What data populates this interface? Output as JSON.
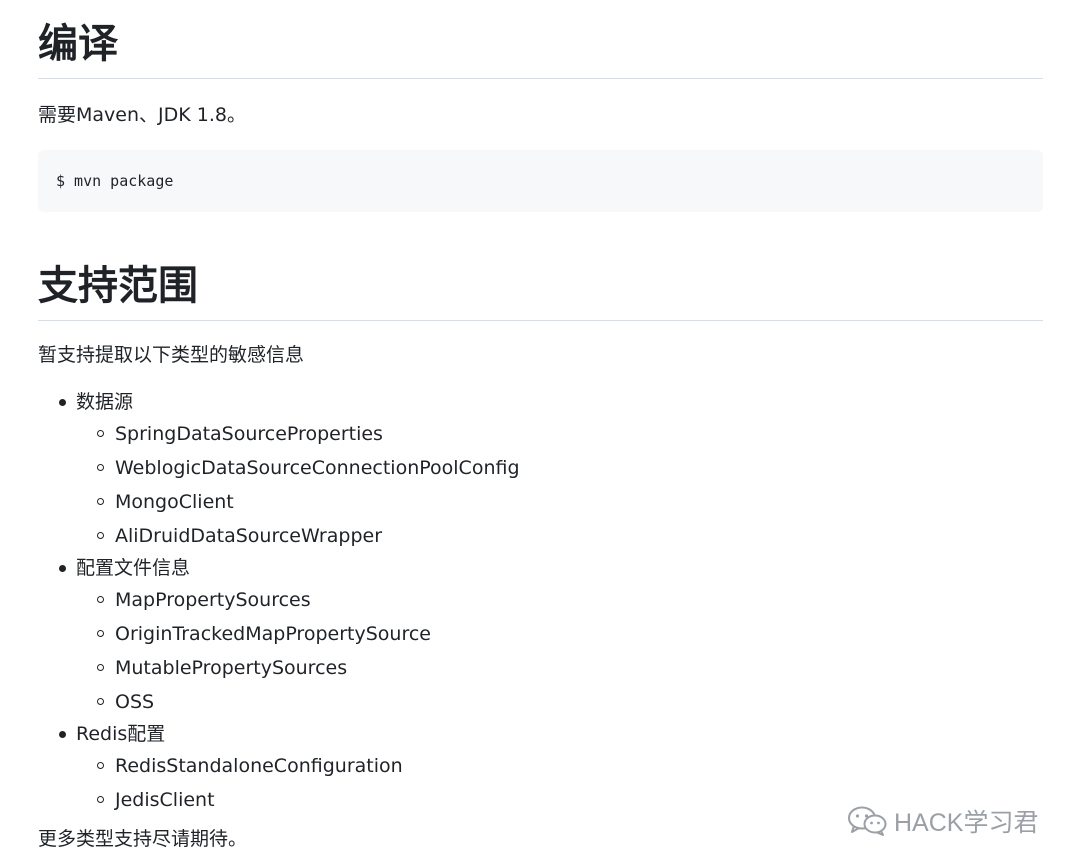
{
  "sections": {
    "compile": {
      "heading": "编译",
      "requirement": "需要Maven、JDK 1.8。",
      "code": "$ mvn package"
    },
    "scope": {
      "heading": "支持范围",
      "intro": "暂支持提取以下类型的敏感信息",
      "groups": [
        {
          "label": "数据源",
          "items": [
            "SpringDataSourceProperties",
            "WeblogicDataSourceConnectionPoolConfig",
            "MongoClient",
            "AliDruidDataSourceWrapper"
          ]
        },
        {
          "label": "配置文件信息",
          "items": [
            "MapPropertySources",
            "OriginTrackedMapPropertySource",
            "MutablePropertySources",
            "OSS"
          ]
        },
        {
          "label": "Redis配置",
          "items": [
            "RedisStandaloneConfiguration",
            "JedisClient"
          ]
        }
      ],
      "footer": "更多类型支持尽请期待。"
    }
  },
  "watermark": {
    "icon": "wechat-icon",
    "text": "HACK学习君",
    "color": "#9aa0a6"
  }
}
